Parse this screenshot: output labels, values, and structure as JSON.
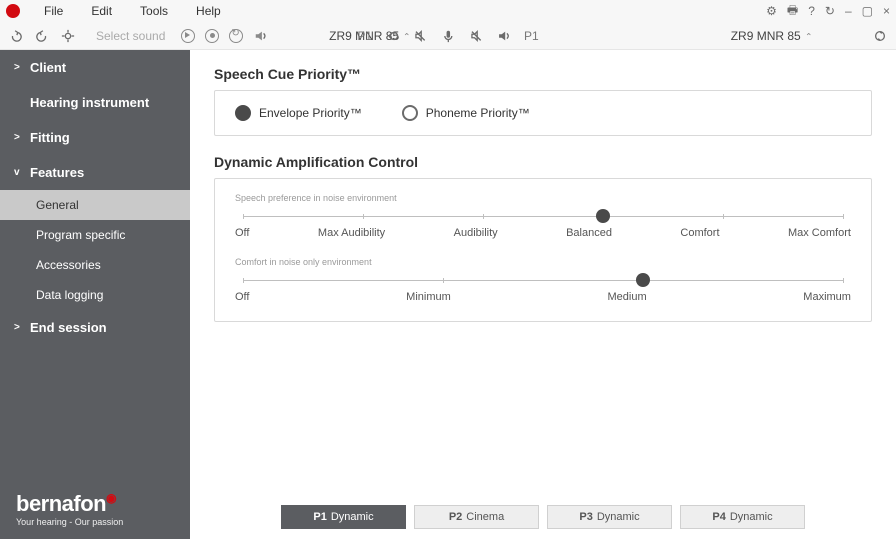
{
  "menu": {
    "file": "File",
    "edit": "Edit",
    "tools": "Tools",
    "help": "Help"
  },
  "win_icons": {
    "settings": "⚙",
    "print": "🖶",
    "help": "?",
    "refresh": "↻",
    "minimize": "–",
    "maximize": "▢",
    "close": "×"
  },
  "toolbar": {
    "select_sound": "Select sound",
    "left_device": "ZR9 MNR 85",
    "right_device": "ZR9 MNR 85",
    "p_label": "P1"
  },
  "sidebar": {
    "items": [
      {
        "label": "Client",
        "caret": ">"
      },
      {
        "label": "Hearing instrument",
        "caret": ""
      },
      {
        "label": "Fitting",
        "caret": ">"
      },
      {
        "label": "Features",
        "caret": "v"
      },
      {
        "label": "End session",
        "caret": ">"
      }
    ],
    "sub": [
      {
        "label": "General",
        "selected": true
      },
      {
        "label": "Program specific",
        "selected": false
      },
      {
        "label": "Accessories",
        "selected": false
      },
      {
        "label": "Data logging",
        "selected": false
      }
    ]
  },
  "brand": {
    "name": "bernafon",
    "tag": "Your hearing - Our passion"
  },
  "speech_cue": {
    "title": "Speech Cue Priority™",
    "opt1": "Envelope Priority™",
    "opt2": "Phoneme Priority™",
    "selected": "opt1"
  },
  "dac": {
    "title": "Dynamic Amplification Control",
    "slider1": {
      "caption": "Speech preference in noise environment",
      "labels": [
        "Off",
        "Max Audibility",
        "Audibility",
        "Balanced",
        "Comfort",
        "Max Comfort"
      ],
      "value_index": 3
    },
    "slider2": {
      "caption": "Comfort in noise only environment",
      "labels": [
        "Off",
        "Minimum",
        "Medium",
        "Maximum"
      ],
      "value_index": 2
    }
  },
  "programs": [
    {
      "p": "P1",
      "name": "Dynamic",
      "active": true
    },
    {
      "p": "P2",
      "name": "Cinema",
      "active": false
    },
    {
      "p": "P3",
      "name": "Dynamic",
      "active": false
    },
    {
      "p": "P4",
      "name": "Dynamic",
      "active": false
    }
  ]
}
